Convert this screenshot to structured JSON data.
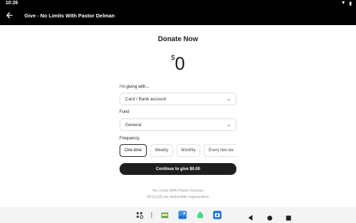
{
  "status": {
    "time": "10:26"
  },
  "appbar": {
    "back_icon": "arrow-left-icon",
    "title": "Give - No Limits With Pastor Delman"
  },
  "donate": {
    "heading": "Donate Now",
    "currency": "$",
    "amount": "0",
    "giving_label": "I'm giving with...",
    "giving_value": "Card / Bank account",
    "fund_label": "Fund",
    "fund_value": "General",
    "frequency_label": "Frequency",
    "frequencies": [
      "One-time",
      "Weekly",
      "Monthly",
      "Every two we"
    ],
    "selected_frequency": "One-time",
    "cta": "Continue to give $0.00"
  },
  "org": {
    "name": "No Limits With Pastor Delman",
    "tax": "501(c)(3) tax deductible organization"
  }
}
